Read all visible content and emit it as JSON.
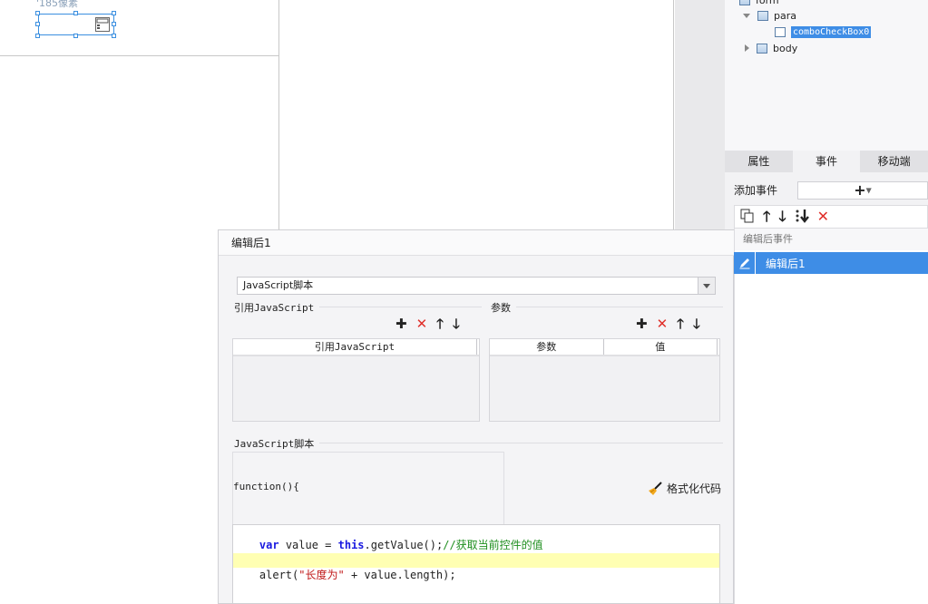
{
  "canvas": {
    "size_hint": "'185像素"
  },
  "tree": {
    "items": [
      {
        "label": "form"
      },
      {
        "label": "para"
      },
      {
        "label": "comboCheckBox0"
      },
      {
        "label": "body"
      }
    ]
  },
  "tabs": [
    {
      "label": "属性"
    },
    {
      "label": "事件"
    },
    {
      "label": "移动端"
    }
  ],
  "events": {
    "add_label": "添加事件",
    "add_symbol": "+",
    "list_header": "编辑后事件",
    "items": [
      {
        "label": "编辑后1"
      }
    ]
  },
  "dialog": {
    "title": "编辑后1",
    "type_value": "JavaScript脚本",
    "ref_group_label": "引用JavaScript",
    "param_group_label": "参数",
    "ref_table_header": "引用JavaScript",
    "param_table_headers": [
      "参数",
      "值"
    ],
    "script_group_label": "JavaScript脚本",
    "function_line": "function(){",
    "format_button": "格式化代码",
    "code": {
      "line1_kw1": "var",
      "line1_mid": " value = ",
      "line1_kw2": "this",
      "line1_call": ".getValue();",
      "line1_comment": "//获取当前控件的值",
      "line2_fn": "alert(",
      "line2_str": "\"长度为\"",
      "line2_rest": " + value.length);"
    }
  },
  "colors": {
    "accent": "#3e8de6",
    "delete": "#e0302b",
    "highlight_line": "#ffffb3"
  }
}
